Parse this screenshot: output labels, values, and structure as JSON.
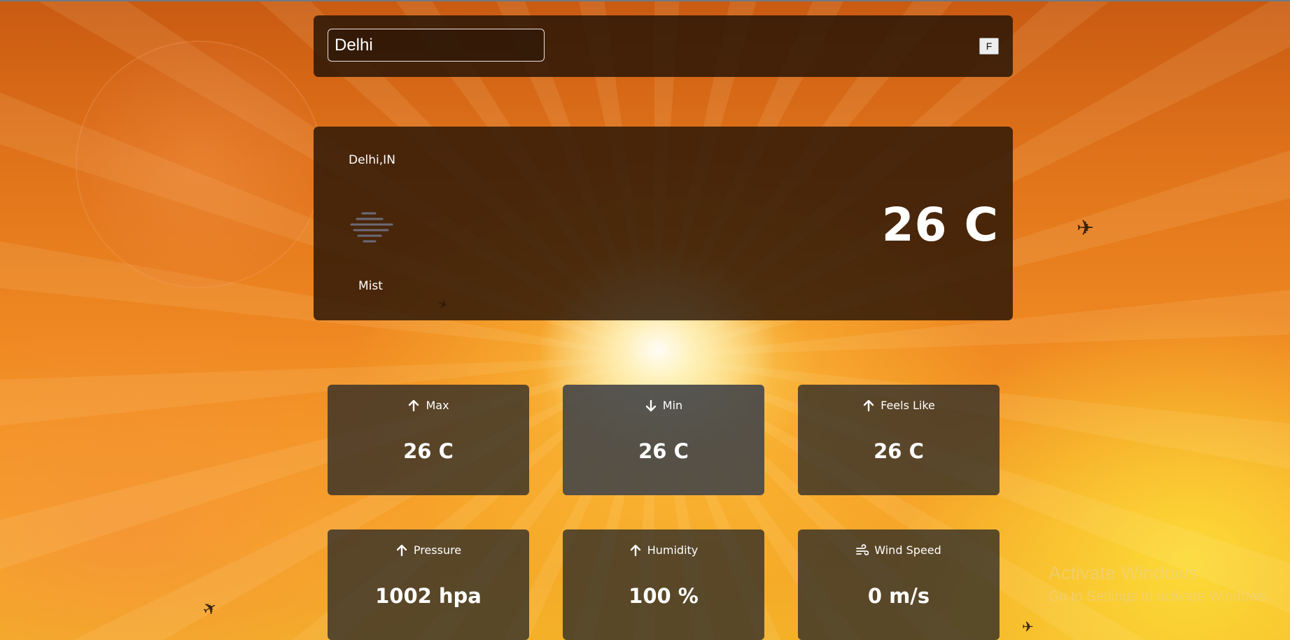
{
  "search": {
    "value": "Delhi",
    "unit_toggle": "F"
  },
  "current": {
    "location": "Delhi,IN",
    "condition": "Mist",
    "condition_icon": "mist-icon",
    "temperature": "26 C"
  },
  "stats": [
    {
      "label": "Max",
      "value": "26 C",
      "icon": "arrow-up-icon"
    },
    {
      "label": "Min",
      "value": "26 C",
      "icon": "arrow-down-icon"
    },
    {
      "label": "Feels Like",
      "value": "26 C",
      "icon": "arrow-up-icon"
    },
    {
      "label": "Pressure",
      "value": "1002 hpa",
      "icon": "arrow-up-icon"
    },
    {
      "label": "Humidity",
      "value": "100 %",
      "icon": "arrow-up-icon"
    },
    {
      "label": "Wind Speed",
      "value": "0 m/s",
      "icon": "wind-icon"
    }
  ],
  "os_watermark": {
    "title": "Activate Windows",
    "subtitle": "Go to Settings to activate Windows."
  },
  "colors": {
    "panel": "#2b1606",
    "stat_card": "#282828",
    "text": "#ffffff",
    "sky_orange": "#f08a22"
  }
}
